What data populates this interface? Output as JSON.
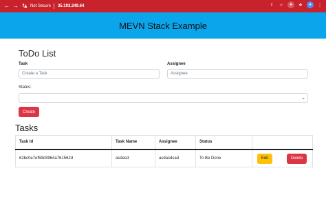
{
  "browser": {
    "security_label": "Not Secure",
    "url": "35.193.249.64"
  },
  "header": {
    "title": "MEVN Stack Example"
  },
  "form": {
    "title": "ToDo List",
    "task_label": "Task",
    "task_placeholder": "Create a Task",
    "assignee_label": "Assignee",
    "assignee_placeholder": "Assignee",
    "status_label": "Status:",
    "status_value": "",
    "create_label": "Create"
  },
  "tasks": {
    "title": "Tasks",
    "columns": [
      "Task Id",
      "Task Name",
      "Assignee",
      "Status"
    ],
    "rows": [
      {
        "id": "62bc0e7ef59d3964a761562d",
        "name": "asdasd",
        "assignee": "asdasdsad",
        "status": "To Be Done",
        "edit_label": "Edit",
        "delete_label": "Delete"
      }
    ]
  },
  "colors": {
    "chrome": "#c8232c",
    "header": "#0ba5ec",
    "danger": "#dc3545",
    "warning": "#ffc107"
  }
}
